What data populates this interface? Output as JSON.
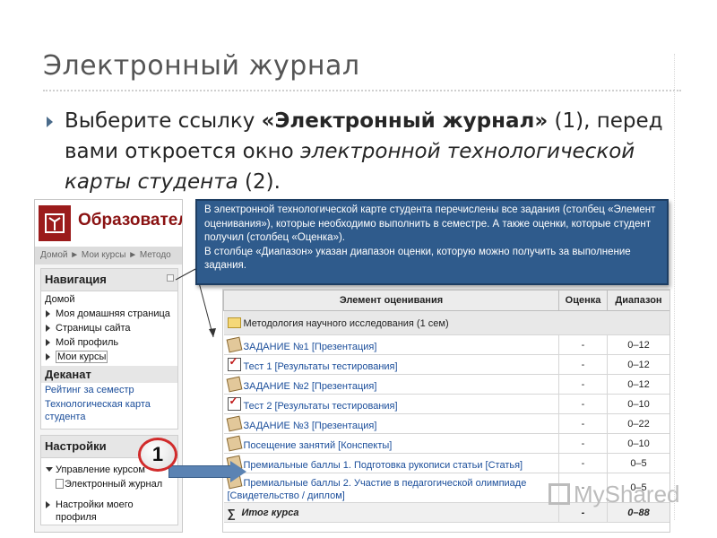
{
  "slide": {
    "title": "Электронный журнал",
    "para_1": "Выберите ссылку ",
    "para_bold": "«Электронный журнал»",
    "para_2": " (1), перед вами откроется окно ",
    "para_italic": "электронной технологической карты студента",
    "para_3": " (2)."
  },
  "moodle": {
    "logo_text": "Образовательн",
    "breadcrumbs": "Домой ► Мои курсы ► Методо",
    "navigation": {
      "title": "Навигация",
      "home": "Домой",
      "items": [
        "Моя домашняя страница",
        "Страницы сайта",
        "Мой профиль",
        "Мои курсы"
      ]
    },
    "dekanat": {
      "title": "Деканат",
      "links": [
        "Рейтинг за семестр",
        "Технологическая карта студента"
      ]
    },
    "settings": {
      "title": "Настройки",
      "items": [
        "Управление курсом",
        "Электронный журнал",
        "Настройки моего профиля"
      ]
    }
  },
  "callout": {
    "line_1": "В электронной технологической карте студента перечислены все задания (столбец «Элемент оценивания»), которые необходимо выполнить в семестре. А также оценки, которые студент получил (столбец «Оценка»).",
    "line_2": "В столбце «Диапазон» указан диапазон оценки, которую можно получить за выполнение задания."
  },
  "grade_table": {
    "headers": [
      "Элемент оценивания",
      "Оценка",
      "Диапазон"
    ],
    "category": "Методология научного исследования (1 сем)",
    "rows": [
      {
        "icon": "assignment-icon",
        "item": "ЗАДАНИЕ №1 [Презентация]",
        "grade": "-",
        "range": "0–12"
      },
      {
        "icon": "test-icon",
        "item": "Тест 1 [Результаты тестирования]",
        "grade": "-",
        "range": "0–12"
      },
      {
        "icon": "assignment-icon",
        "item": "ЗАДАНИЕ №2 [Презентация]",
        "grade": "-",
        "range": "0–12"
      },
      {
        "icon": "test-icon",
        "item": "Тест 2 [Результаты тестирования]",
        "grade": "-",
        "range": "0–10"
      },
      {
        "icon": "assignment-icon",
        "item": "ЗАДАНИЕ №3 [Презентация]",
        "grade": "-",
        "range": "0–22"
      },
      {
        "icon": "assignment-icon",
        "item": "Посещение занятий [Конспекты]",
        "grade": "-",
        "range": "0–10"
      },
      {
        "icon": "assignment-icon",
        "item": "Премиальные баллы 1. Подготовка рукописи статьи [Статья]",
        "grade": "-",
        "range": "0–5"
      },
      {
        "icon": "assignment-icon",
        "item": "Премиальные баллы 2. Участие в педагогической олимпиаде",
        "item_2": "[Свидетельство / диплом]",
        "grade": "-",
        "range": "0–5"
      }
    ],
    "total": {
      "label": "Итог курса",
      "grade": "-",
      "range": "0–88"
    }
  },
  "marker": {
    "number": "1"
  },
  "watermark": "MyShared"
}
